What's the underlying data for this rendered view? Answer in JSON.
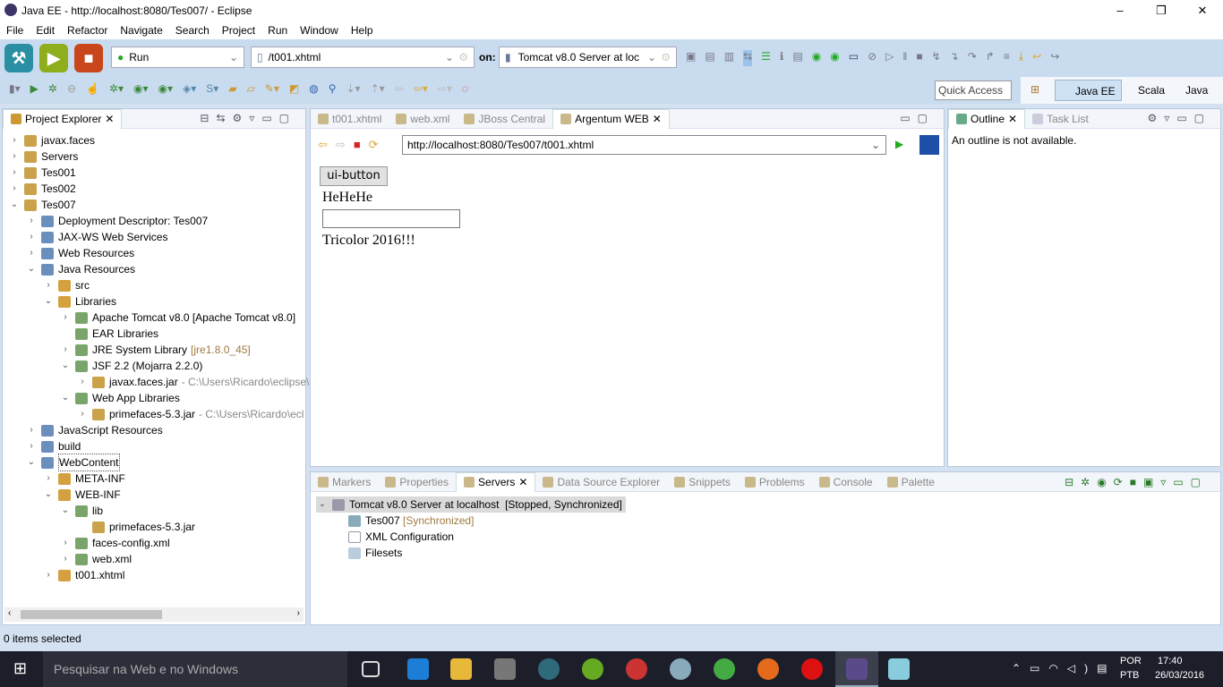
{
  "window": {
    "title": "Java EE - http://localhost:8080/Tes007/ - Eclipse",
    "minimize": "–",
    "restore": "❐",
    "close": "✕"
  },
  "menu": [
    "File",
    "Edit",
    "Refactor",
    "Navigate",
    "Search",
    "Project",
    "Run",
    "Window",
    "Help"
  ],
  "toolbar": {
    "launch_mode": "Run",
    "launch_config": "/t001.xhtml",
    "on_label": "on:",
    "target": "Tomcat v8.0 Server at loc",
    "quick_access": "Quick Access",
    "perspectives": [
      "Java EE",
      "Scala",
      "Java"
    ]
  },
  "explorer": {
    "title": "Project Explorer",
    "items": [
      {
        "label": "javax.faces",
        "level": 0,
        "arrow": ">"
      },
      {
        "label": "Servers",
        "level": 0,
        "arrow": ">"
      },
      {
        "label": "Tes001",
        "level": 0,
        "arrow": ">"
      },
      {
        "label": "Tes002",
        "level": 0,
        "arrow": ">"
      },
      {
        "label": "Tes007",
        "level": 0,
        "arrow": "v"
      },
      {
        "label": "Deployment Descriptor: Tes007",
        "level": 1,
        "arrow": ">"
      },
      {
        "label": "JAX-WS Web Services",
        "level": 1,
        "arrow": ">"
      },
      {
        "label": "Web Resources",
        "level": 1,
        "arrow": ">"
      },
      {
        "label": "Java Resources",
        "level": 1,
        "arrow": "v"
      },
      {
        "label": "src",
        "level": 2,
        "arrow": ">"
      },
      {
        "label": "Libraries",
        "level": 2,
        "arrow": "v"
      },
      {
        "label": "Apache Tomcat v8.0 [Apache Tomcat v8.0]",
        "level": 3,
        "arrow": ">"
      },
      {
        "label": "EAR Libraries",
        "level": 3,
        "arrow": ""
      },
      {
        "label": "JRE System Library",
        "decor": "[jre1.8.0_45]",
        "level": 3,
        "arrow": ">"
      },
      {
        "label": "JSF 2.2 (Mojarra 2.2.0)",
        "level": 3,
        "arrow": "v"
      },
      {
        "label": "javax.faces.jar",
        "decor": "- C:\\Users\\Ricardo\\eclipse\\",
        "level": 4,
        "arrow": ">"
      },
      {
        "label": "Web App Libraries",
        "level": 3,
        "arrow": "v"
      },
      {
        "label": "primefaces-5.3.jar",
        "decor": "- C:\\Users\\Ricardo\\ecl",
        "level": 4,
        "arrow": ">"
      },
      {
        "label": "JavaScript Resources",
        "level": 1,
        "arrow": ">"
      },
      {
        "label": "build",
        "level": 1,
        "arrow": ">"
      },
      {
        "label": "WebContent",
        "level": 1,
        "arrow": "v"
      },
      {
        "label": "META-INF",
        "level": 2,
        "arrow": ">"
      },
      {
        "label": "WEB-INF",
        "level": 2,
        "arrow": "v"
      },
      {
        "label": "lib",
        "level": 3,
        "arrow": "v"
      },
      {
        "label": "primefaces-5.3.jar",
        "level": 4,
        "arrow": ""
      },
      {
        "label": "faces-config.xml",
        "level": 3,
        "arrow": ">"
      },
      {
        "label": "web.xml",
        "level": 3,
        "arrow": ">"
      },
      {
        "label": "t001.xhtml",
        "level": 2,
        "arrow": ">"
      }
    ]
  },
  "editor": {
    "tabs": [
      "t001.xhtml",
      "web.xml",
      "JBoss Central",
      "Argentum WEB"
    ],
    "active_tab": 3,
    "url": "http://localhost:8080/Tes007/t001.xhtml",
    "page": {
      "button": "ui-button",
      "text1": "HeHeHe",
      "input_value": "",
      "text2": "Tricolor 2016!!!"
    }
  },
  "outline": {
    "tabs": [
      "Outline",
      "Task List"
    ],
    "message": "An outline is not available."
  },
  "bottom": {
    "tabs": [
      "Markers",
      "Properties",
      "Servers",
      "Data Source Explorer",
      "Snippets",
      "Problems",
      "Console",
      "Palette"
    ],
    "active_tab": 2,
    "server": {
      "label": "Tomcat v8.0 Server at localhost",
      "state": "[Stopped, Synchronized]",
      "children": [
        {
          "label": "Tes007",
          "decor": "[Synchronized]"
        },
        {
          "label": "XML Configuration",
          "decor": ""
        },
        {
          "label": "Filesets",
          "decor": ""
        }
      ]
    }
  },
  "status": {
    "text": "0 items selected"
  },
  "taskbar": {
    "search": "Pesquisar na Web e no Windows",
    "lang1": "POR",
    "lang2": "PTB",
    "time": "17:40",
    "date": "26/03/2016"
  }
}
